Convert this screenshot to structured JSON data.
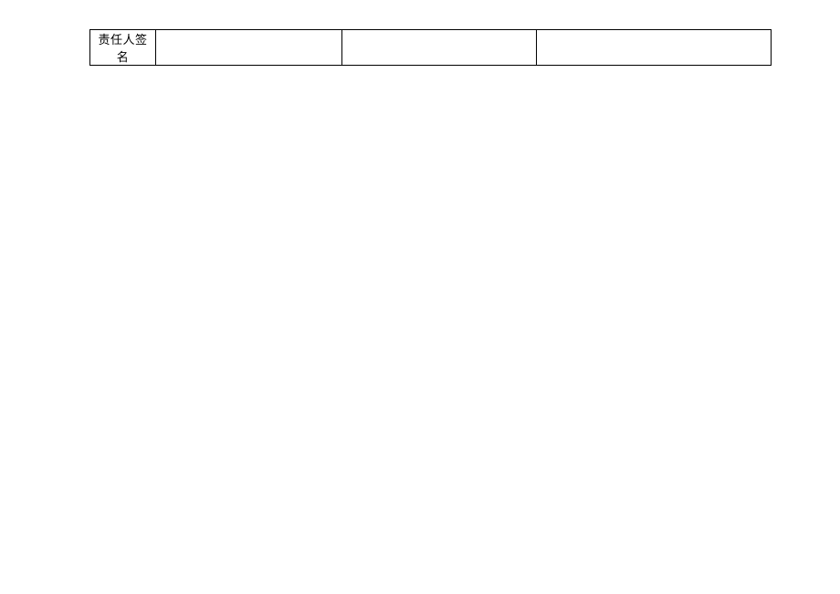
{
  "table": {
    "row_label": "责任人签名",
    "fields": [
      "",
      "",
      ""
    ]
  }
}
